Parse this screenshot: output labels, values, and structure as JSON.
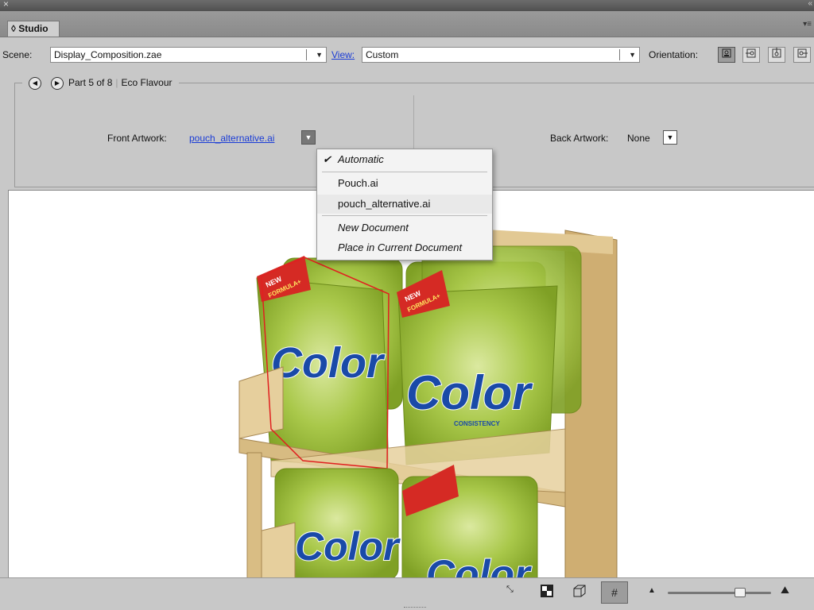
{
  "window": {
    "close_glyph": "×",
    "collapse_glyph": "«"
  },
  "panel": {
    "tab_label": "◊ Studio",
    "menu_glyph": "▾≡"
  },
  "scene": {
    "label": "Scene:",
    "value": "Display_Composition.zae",
    "view_label": "View:",
    "view_value": "Custom",
    "orientation_label": "Orientation:",
    "orientation_icons": [
      "orientation-front-icon",
      "orientation-side-icon",
      "orientation-top-icon",
      "orientation-back-icon"
    ]
  },
  "part": {
    "prev_glyph": "◀",
    "next_glyph": "▶",
    "counter": "Part 5 of 8",
    "name": "Eco Flavour"
  },
  "artwork": {
    "front_label": "Front Artwork:",
    "front_value": "pouch_alternative.ai",
    "back_label": "Back Artwork:",
    "back_value": "None"
  },
  "menu": {
    "items": [
      {
        "label": "Automatic",
        "checked": true,
        "italic": true
      },
      {
        "label": "Pouch.ai",
        "checked": false,
        "italic": false
      },
      {
        "label": "pouch_alternative.ai",
        "checked": false,
        "italic": false,
        "highlighted": true
      },
      {
        "label": "New Document",
        "checked": false,
        "italic": true
      },
      {
        "label": "Place in Current Document",
        "checked": false,
        "italic": true
      }
    ],
    "check_glyph": "✔"
  },
  "product": {
    "brand": "Color",
    "banner_line1": "NEW",
    "banner_line2": "FORMULA+",
    "tagline": "CONSISTENCY"
  },
  "bottombar": {
    "icons": [
      "fit-view-icon",
      "checker-icon",
      "cube-icon",
      "grid-icon",
      "zoom-out-icon",
      "zoom-in-icon"
    ],
    "zoom_level": 0.68
  },
  "colors": {
    "accent_link": "#1a3cd6",
    "highlight_outline": "#e02020",
    "shelf_wood": "#dcc08a",
    "pouch_green": "#9cc33a"
  }
}
